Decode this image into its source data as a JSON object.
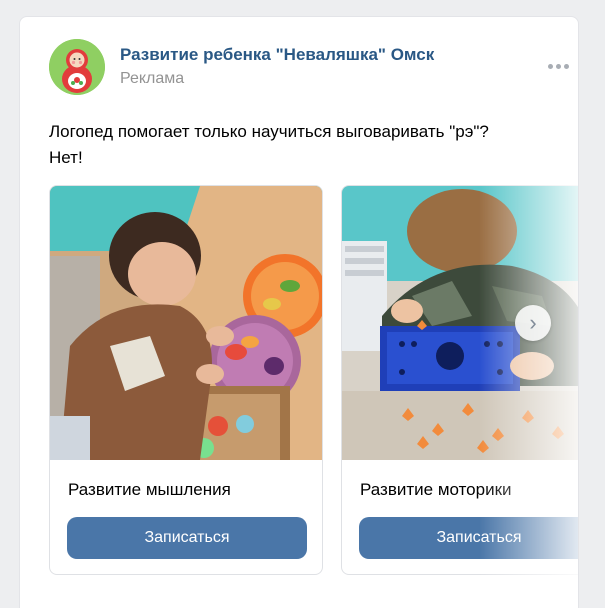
{
  "post": {
    "group_name": "Развитие ребенка \"Неваляшка\" Омск",
    "ad_label": "Реклама",
    "text_line1": "Логопед помогает только научиться выговаривать \"рэ\"?",
    "text_line2": "Нет!",
    "more_icon": "more-dots-icon"
  },
  "carousel": {
    "next_icon": "chevron-right-icon",
    "next_glyph": "›",
    "cards": [
      {
        "title": "Развитие мышления",
        "button_label": "Записаться"
      },
      {
        "title": "Развитие моторики",
        "button_label": "Записаться"
      }
    ]
  },
  "colors": {
    "link": "#2a5885",
    "button": "#4a76a8",
    "muted": "#939393"
  }
}
